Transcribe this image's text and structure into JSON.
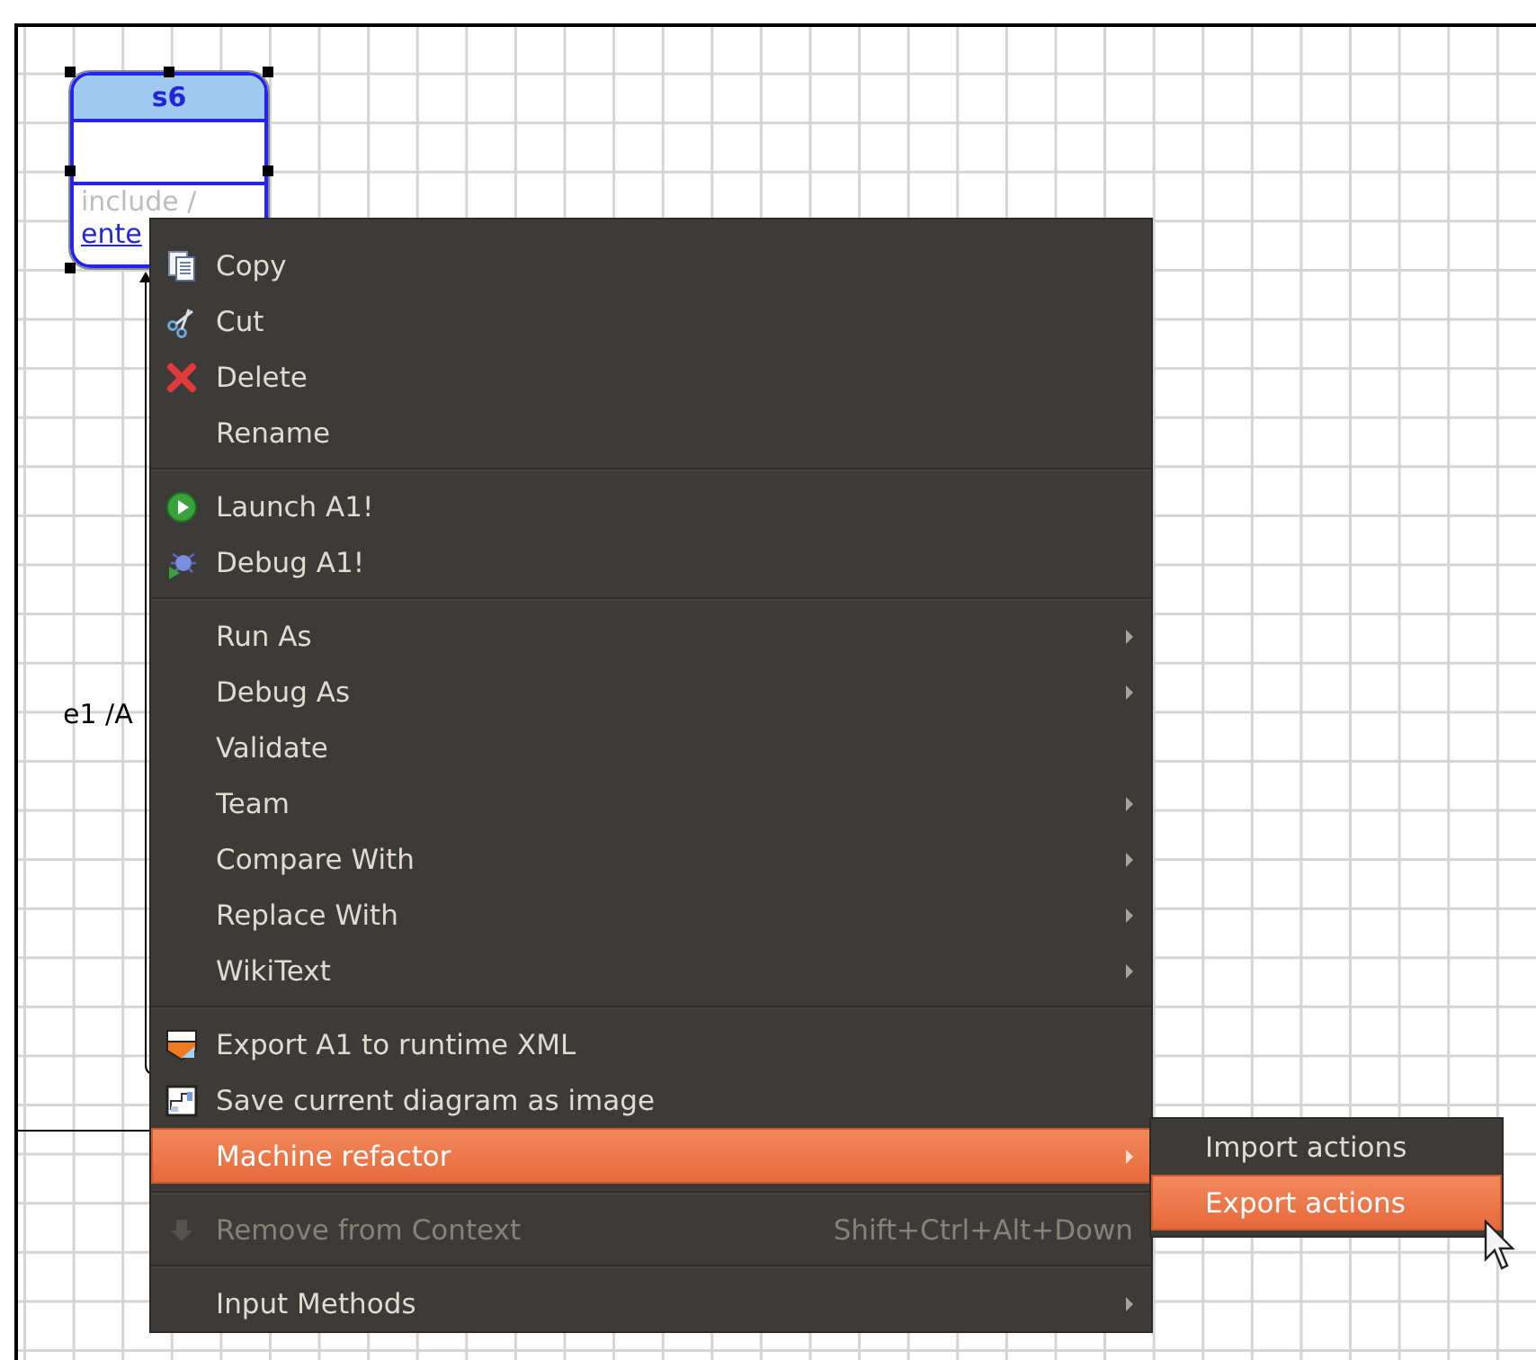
{
  "diagram": {
    "state": {
      "name": "s6",
      "selected": true,
      "include_text": "include /",
      "entry_text": "ente"
    },
    "transition_label": "e1 /A"
  },
  "context_menu": {
    "items": [
      {
        "kind": "item",
        "label": "Copy",
        "submenu": false,
        "disabled": false,
        "selected": false
      },
      {
        "kind": "item",
        "label": "Cut",
        "submenu": false,
        "disabled": false,
        "selected": false
      },
      {
        "kind": "item",
        "label": "Delete",
        "submenu": false,
        "disabled": false,
        "selected": false
      },
      {
        "kind": "item",
        "label": "Rename",
        "submenu": false,
        "disabled": false,
        "selected": false
      },
      {
        "kind": "separator"
      },
      {
        "kind": "item",
        "label": "Launch A1!",
        "submenu": false,
        "disabled": false,
        "selected": false
      },
      {
        "kind": "item",
        "label": "Debug A1!",
        "submenu": false,
        "disabled": false,
        "selected": false
      },
      {
        "kind": "separator"
      },
      {
        "kind": "item",
        "label": "Run As",
        "submenu": true,
        "disabled": false,
        "selected": false
      },
      {
        "kind": "item",
        "label": "Debug As",
        "submenu": true,
        "disabled": false,
        "selected": false
      },
      {
        "kind": "item",
        "label": "Validate",
        "submenu": false,
        "disabled": false,
        "selected": false
      },
      {
        "kind": "item",
        "label": "Team",
        "submenu": true,
        "disabled": false,
        "selected": false
      },
      {
        "kind": "item",
        "label": "Compare With",
        "submenu": true,
        "disabled": false,
        "selected": false
      },
      {
        "kind": "item",
        "label": "Replace With",
        "submenu": true,
        "disabled": false,
        "selected": false
      },
      {
        "kind": "item",
        "label": "WikiText",
        "submenu": true,
        "disabled": false,
        "selected": false
      },
      {
        "kind": "separator"
      },
      {
        "kind": "item",
        "label": "Export A1 to runtime XML",
        "submenu": false,
        "disabled": false,
        "selected": false
      },
      {
        "kind": "item",
        "label": "Save current diagram as image",
        "submenu": false,
        "disabled": false,
        "selected": false
      },
      {
        "kind": "item",
        "label": "Machine refactor",
        "submenu": true,
        "disabled": false,
        "selected": true
      },
      {
        "kind": "separator"
      },
      {
        "kind": "item",
        "label": "Remove from Context",
        "shortcut": "Shift+Ctrl+Alt+Down",
        "submenu": false,
        "disabled": true,
        "selected": false
      },
      {
        "kind": "separator"
      },
      {
        "kind": "item",
        "label": "Input Methods",
        "submenu": true,
        "disabled": false,
        "selected": false
      }
    ]
  },
  "submenu": {
    "items": [
      {
        "label": "Import actions",
        "selected": false
      },
      {
        "label": "Export actions",
        "selected": true
      }
    ]
  }
}
